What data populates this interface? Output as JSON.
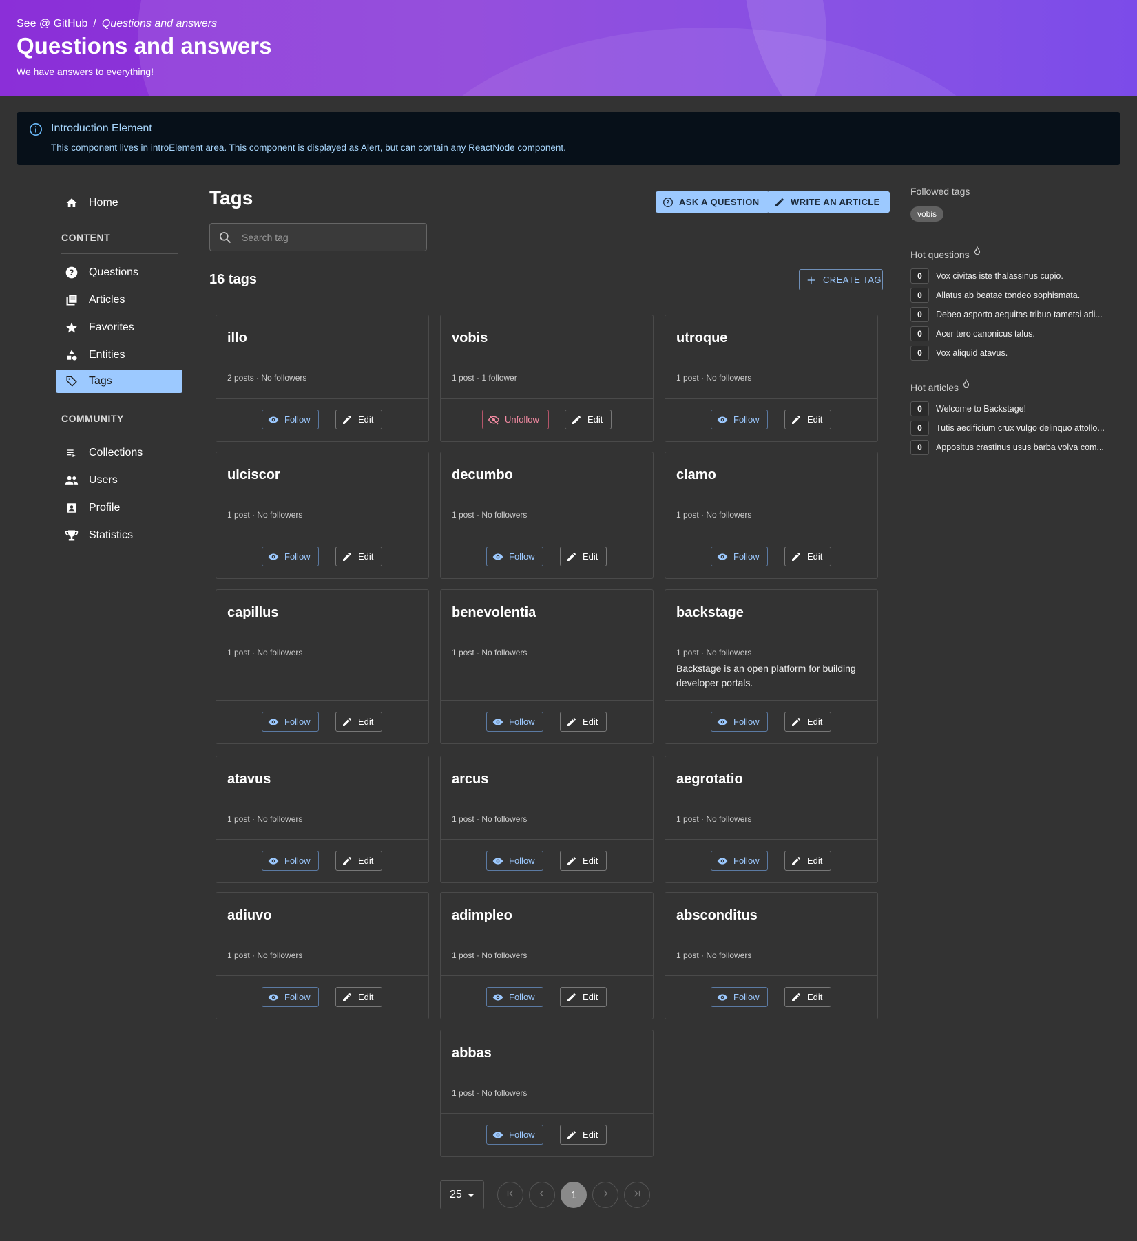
{
  "header": {
    "breadcrumb_link": "See @ GitHub",
    "breadcrumb_sep": "/",
    "breadcrumb_current": "Questions and answers",
    "title": "Questions and answers",
    "subtitle": "We have answers to everything!"
  },
  "alert": {
    "title": "Introduction Element",
    "body": "This component lives in introElement area. This component is displayed as Alert, but can contain any ReactNode component."
  },
  "sidebar": {
    "home": "Home",
    "content_heading": "CONTENT",
    "content_items": [
      {
        "label": "Questions",
        "icon": "question-icon"
      },
      {
        "label": "Articles",
        "icon": "articles-icon"
      },
      {
        "label": "Favorites",
        "icon": "star-icon"
      },
      {
        "label": "Entities",
        "icon": "entities-icon"
      },
      {
        "label": "Tags",
        "icon": "tag-icon"
      }
    ],
    "community_heading": "COMMUNITY",
    "community_items": [
      {
        "label": "Collections",
        "icon": "collections-icon"
      },
      {
        "label": "Users",
        "icon": "users-icon"
      },
      {
        "label": "Profile",
        "icon": "profile-icon"
      },
      {
        "label": "Statistics",
        "icon": "trophy-icon"
      }
    ]
  },
  "main": {
    "title": "Tags",
    "ask_button": "ASK A QUESTION",
    "write_button": "WRITE AN ARTICLE",
    "search_placeholder": "Search tag",
    "tag_count": "16 tags",
    "create_button": "CREATE TAG",
    "follow_label": "Follow",
    "unfollow_label": "Unfollow",
    "edit_label": "Edit"
  },
  "tags": [
    {
      "name": "illo",
      "meta": "2 posts · No followers",
      "followed": false,
      "description": ""
    },
    {
      "name": "vobis",
      "meta": "1 post · 1 follower",
      "followed": true,
      "description": ""
    },
    {
      "name": "utroque",
      "meta": "1 post · No followers",
      "followed": false,
      "description": ""
    },
    {
      "name": "ulciscor",
      "meta": "1 post · No followers",
      "followed": false,
      "description": ""
    },
    {
      "name": "decumbo",
      "meta": "1 post · No followers",
      "followed": false,
      "description": ""
    },
    {
      "name": "clamo",
      "meta": "1 post · No followers",
      "followed": false,
      "description": ""
    },
    {
      "name": "capillus",
      "meta": "1 post · No followers",
      "followed": false,
      "description": ""
    },
    {
      "name": "benevolentia",
      "meta": "1 post · No followers",
      "followed": false,
      "description": ""
    },
    {
      "name": "backstage",
      "meta": "1 post · No followers",
      "followed": false,
      "description": "Backstage is an open platform for building developer portals."
    },
    {
      "name": "atavus",
      "meta": "1 post · No followers",
      "followed": false,
      "description": ""
    },
    {
      "name": "arcus",
      "meta": "1 post · No followers",
      "followed": false,
      "description": ""
    },
    {
      "name": "aegrotatio",
      "meta": "1 post · No followers",
      "followed": false,
      "description": ""
    },
    {
      "name": "adiuvo",
      "meta": "1 post · No followers",
      "followed": false,
      "description": ""
    },
    {
      "name": "adimpleo",
      "meta": "1 post · No followers",
      "followed": false,
      "description": ""
    },
    {
      "name": "absconditus",
      "meta": "1 post · No followers",
      "followed": false,
      "description": ""
    },
    {
      "name": "abbas",
      "meta": "1 post · No followers",
      "followed": false,
      "description": ""
    }
  ],
  "right": {
    "followed_heading": "Followed tags",
    "followed_tags": [
      "vobis"
    ],
    "hot_questions_heading": "Hot questions",
    "hot_questions": [
      {
        "count": "0",
        "title": "Vox civitas iste thalassinus cupio."
      },
      {
        "count": "0",
        "title": "Allatus ab beatae tondeo sophismata."
      },
      {
        "count": "0",
        "title": "Debeo asporto aequitas tribuo tametsi adi..."
      },
      {
        "count": "0",
        "title": "Acer tero canonicus talus."
      },
      {
        "count": "0",
        "title": "Vox aliquid atavus."
      }
    ],
    "hot_articles_heading": "Hot articles",
    "hot_articles": [
      {
        "count": "0",
        "title": "Welcome to Backstage!"
      },
      {
        "count": "0",
        "title": "Tutis aedificium crux vulgo delinquo attollo..."
      },
      {
        "count": "0",
        "title": "Appositus crastinus usus barba volva com..."
      }
    ]
  },
  "pagination": {
    "page_size": "25",
    "current_page": "1"
  },
  "colors": {
    "accent": "#9cc9ff",
    "background": "#333333",
    "header_gradient_start": "#8b2fd8",
    "header_gradient_end": "#6a33e6",
    "unfollow": "#f48ba3"
  }
}
